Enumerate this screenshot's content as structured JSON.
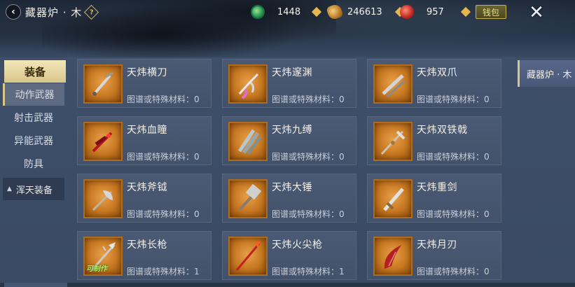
{
  "header": {
    "title": "藏器炉 · 木",
    "help_glyph": "?",
    "wallet_label": "钱包"
  },
  "currencies": [
    {
      "icon": "jade-icon",
      "value": "1448"
    },
    {
      "icon": "gold-coin-icon",
      "value": "246613"
    },
    {
      "icon": "red-orb-icon",
      "value": "957"
    }
  ],
  "sidebar": {
    "top_tab": "装备",
    "items": [
      "动作武器",
      "射击武器",
      "异能武器",
      "防具"
    ],
    "group": "浑天装备"
  },
  "right_tab": "藏器炉 · 木",
  "material_label": "图谱或特殊材料：",
  "craftable_label": "可制作",
  "cards": [
    {
      "name": "天炜横刀",
      "count": "0",
      "weapon": "blade-icon"
    },
    {
      "name": "天炜邃渊",
      "count": "0",
      "weapon": "claw-pink-icon"
    },
    {
      "name": "天炜双爪",
      "count": "0",
      "weapon": "twin-claw-icon"
    },
    {
      "name": "天炜血瞳",
      "count": "0",
      "weapon": "red-claw-icon"
    },
    {
      "name": "天炜九缚",
      "count": "0",
      "weapon": "fan-blade-icon"
    },
    {
      "name": "天炜双铁戟",
      "count": "0",
      "weapon": "halberd-icon"
    },
    {
      "name": "天炜斧钺",
      "count": "0",
      "weapon": "axe-icon"
    },
    {
      "name": "天炜大锤",
      "count": "0",
      "weapon": "hammer-icon"
    },
    {
      "name": "天炜重剑",
      "count": "0",
      "weapon": "greatsword-icon"
    },
    {
      "name": "天炜长枪",
      "count": "1",
      "weapon": "spear-icon",
      "craftable": true
    },
    {
      "name": "天炜火尖枪",
      "count": "1",
      "weapon": "fire-spear-icon"
    },
    {
      "name": "天炜月刃",
      "count": "0",
      "weapon": "moon-blade-icon"
    }
  ],
  "colors": {
    "accent_gold": "#d9c68a",
    "card_bg": "#4b5a74",
    "thumb_orange": "#c67720",
    "craftable_green": "#b6f06a"
  }
}
